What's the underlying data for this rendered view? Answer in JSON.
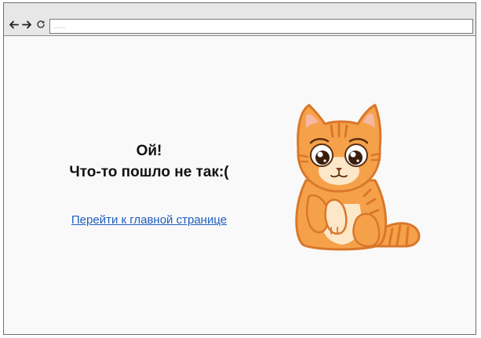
{
  "toolbar": {
    "back_icon": "arrow-left-icon",
    "forward_icon": "arrow-right-icon",
    "reload_icon": "reload-icon",
    "address_value": "......"
  },
  "content": {
    "title_line1": "Ой!",
    "title_line2": "Что-то пошло не так:(",
    "home_link": "Перейти к главной странице",
    "illustration": "sad-cat-icon"
  },
  "colors": {
    "link": "#1f5fbf",
    "cat_orange": "#f5a14a",
    "cat_outline": "#d9772a",
    "page_background": "#f9f9f9",
    "toolbar_background": "#e7e7e7"
  }
}
